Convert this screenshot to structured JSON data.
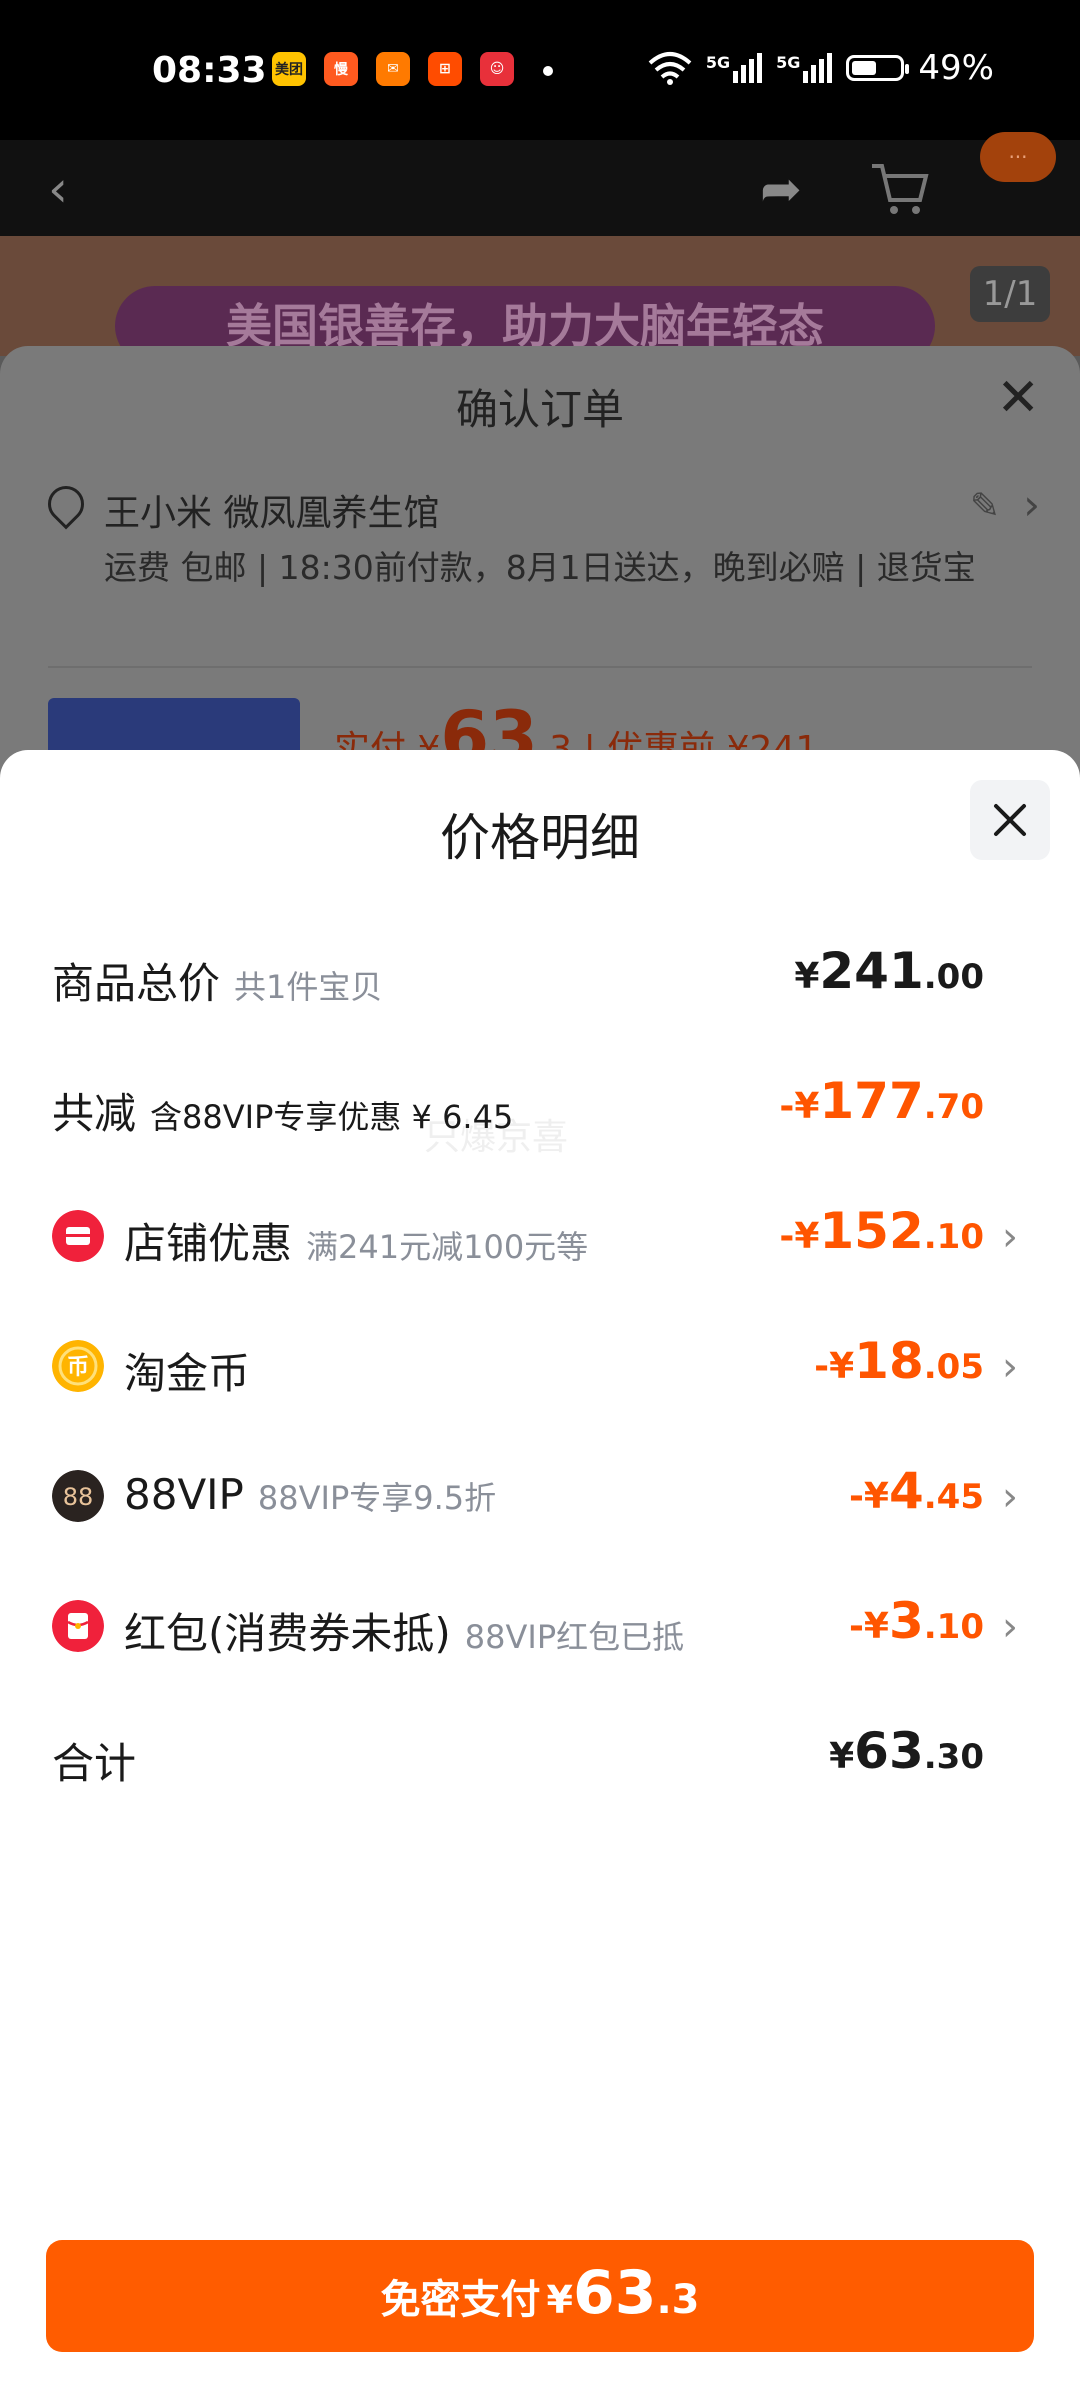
{
  "status_bar": {
    "time": "08:33",
    "app_icons": [
      {
        "name": "meituan-app-icon",
        "label": "美团",
        "color": "#FFC300"
      },
      {
        "name": "manman-app-icon",
        "label": "慢",
        "color": "#FF5A1F"
      },
      {
        "name": "envelope-app-icon",
        "label": "",
        "color": "#FF7A00"
      },
      {
        "name": "grid-app-icon",
        "label": "",
        "color": "#FF4C00"
      },
      {
        "name": "mascot-app-icon",
        "label": "",
        "color": "#E8303A"
      }
    ],
    "network_1": "5G",
    "network_2": "5G",
    "battery": "49%"
  },
  "background_page": {
    "message_badge": "···",
    "banner_text": "美国银善存，助力大脑年轻态",
    "image_index": "1/1"
  },
  "confirm_order": {
    "title": "确认订单",
    "address_name": "王小米 微凤凰养生馆",
    "shipping_info": "运费 包邮 | 18:30前付款，8月1日送达，晚到必赔 | 退货宝",
    "pay_label": "实付",
    "pay_yen": "¥",
    "pay_int": "63",
    "pay_dec": ".3",
    "pre_discount": "| 优惠前 ¥241"
  },
  "price_detail": {
    "title": "价格明细",
    "watermark": "只爆京喜",
    "rows": [
      {
        "label": "商品总价",
        "sub": "共1件宝贝",
        "sign": "",
        "yen": "¥",
        "int": "241",
        "dec": ".00",
        "color": "black"
      },
      {
        "label": "共减",
        "sub": "含88VIP专享优惠 ¥ 6.45",
        "sign": "-",
        "yen": "¥",
        "int": "177",
        "dec": ".70",
        "color": "orange"
      },
      {
        "label": "店铺优惠",
        "sub": "满241元减100元等",
        "sign": "-",
        "yen": "¥",
        "int": "152",
        "dec": ".10",
        "color": "orange",
        "icon": "shop-coupon-icon"
      },
      {
        "label": "淘金币",
        "sub": "",
        "sign": "-",
        "yen": "¥",
        "int": "18",
        "dec": ".05",
        "color": "orange",
        "icon": "coin-icon"
      },
      {
        "label": "88VIP",
        "sub": "88VIP专享9.5折",
        "sign": "-",
        "yen": "¥",
        "int": "4",
        "dec": ".45",
        "color": "orange",
        "icon": "vip88-icon"
      },
      {
        "label": "红包(消费券未抵)",
        "sub": "88VIP红包已抵",
        "sign": "-",
        "yen": "¥",
        "int": "3",
        "dec": ".10",
        "color": "orange",
        "icon": "red-packet-icon"
      },
      {
        "label": "合计",
        "sub": "",
        "sign": "",
        "yen": "¥",
        "int": "63",
        "dec": ".30",
        "color": "black"
      }
    ]
  },
  "pay_button": {
    "label": "免密支付",
    "yen": "¥",
    "int": "63",
    "dec": ".3"
  },
  "colors": {
    "accent": "#FF5500",
    "button": "#FF5C00",
    "text_primary": "#1A1A1A",
    "text_secondary": "#8A8F99"
  }
}
